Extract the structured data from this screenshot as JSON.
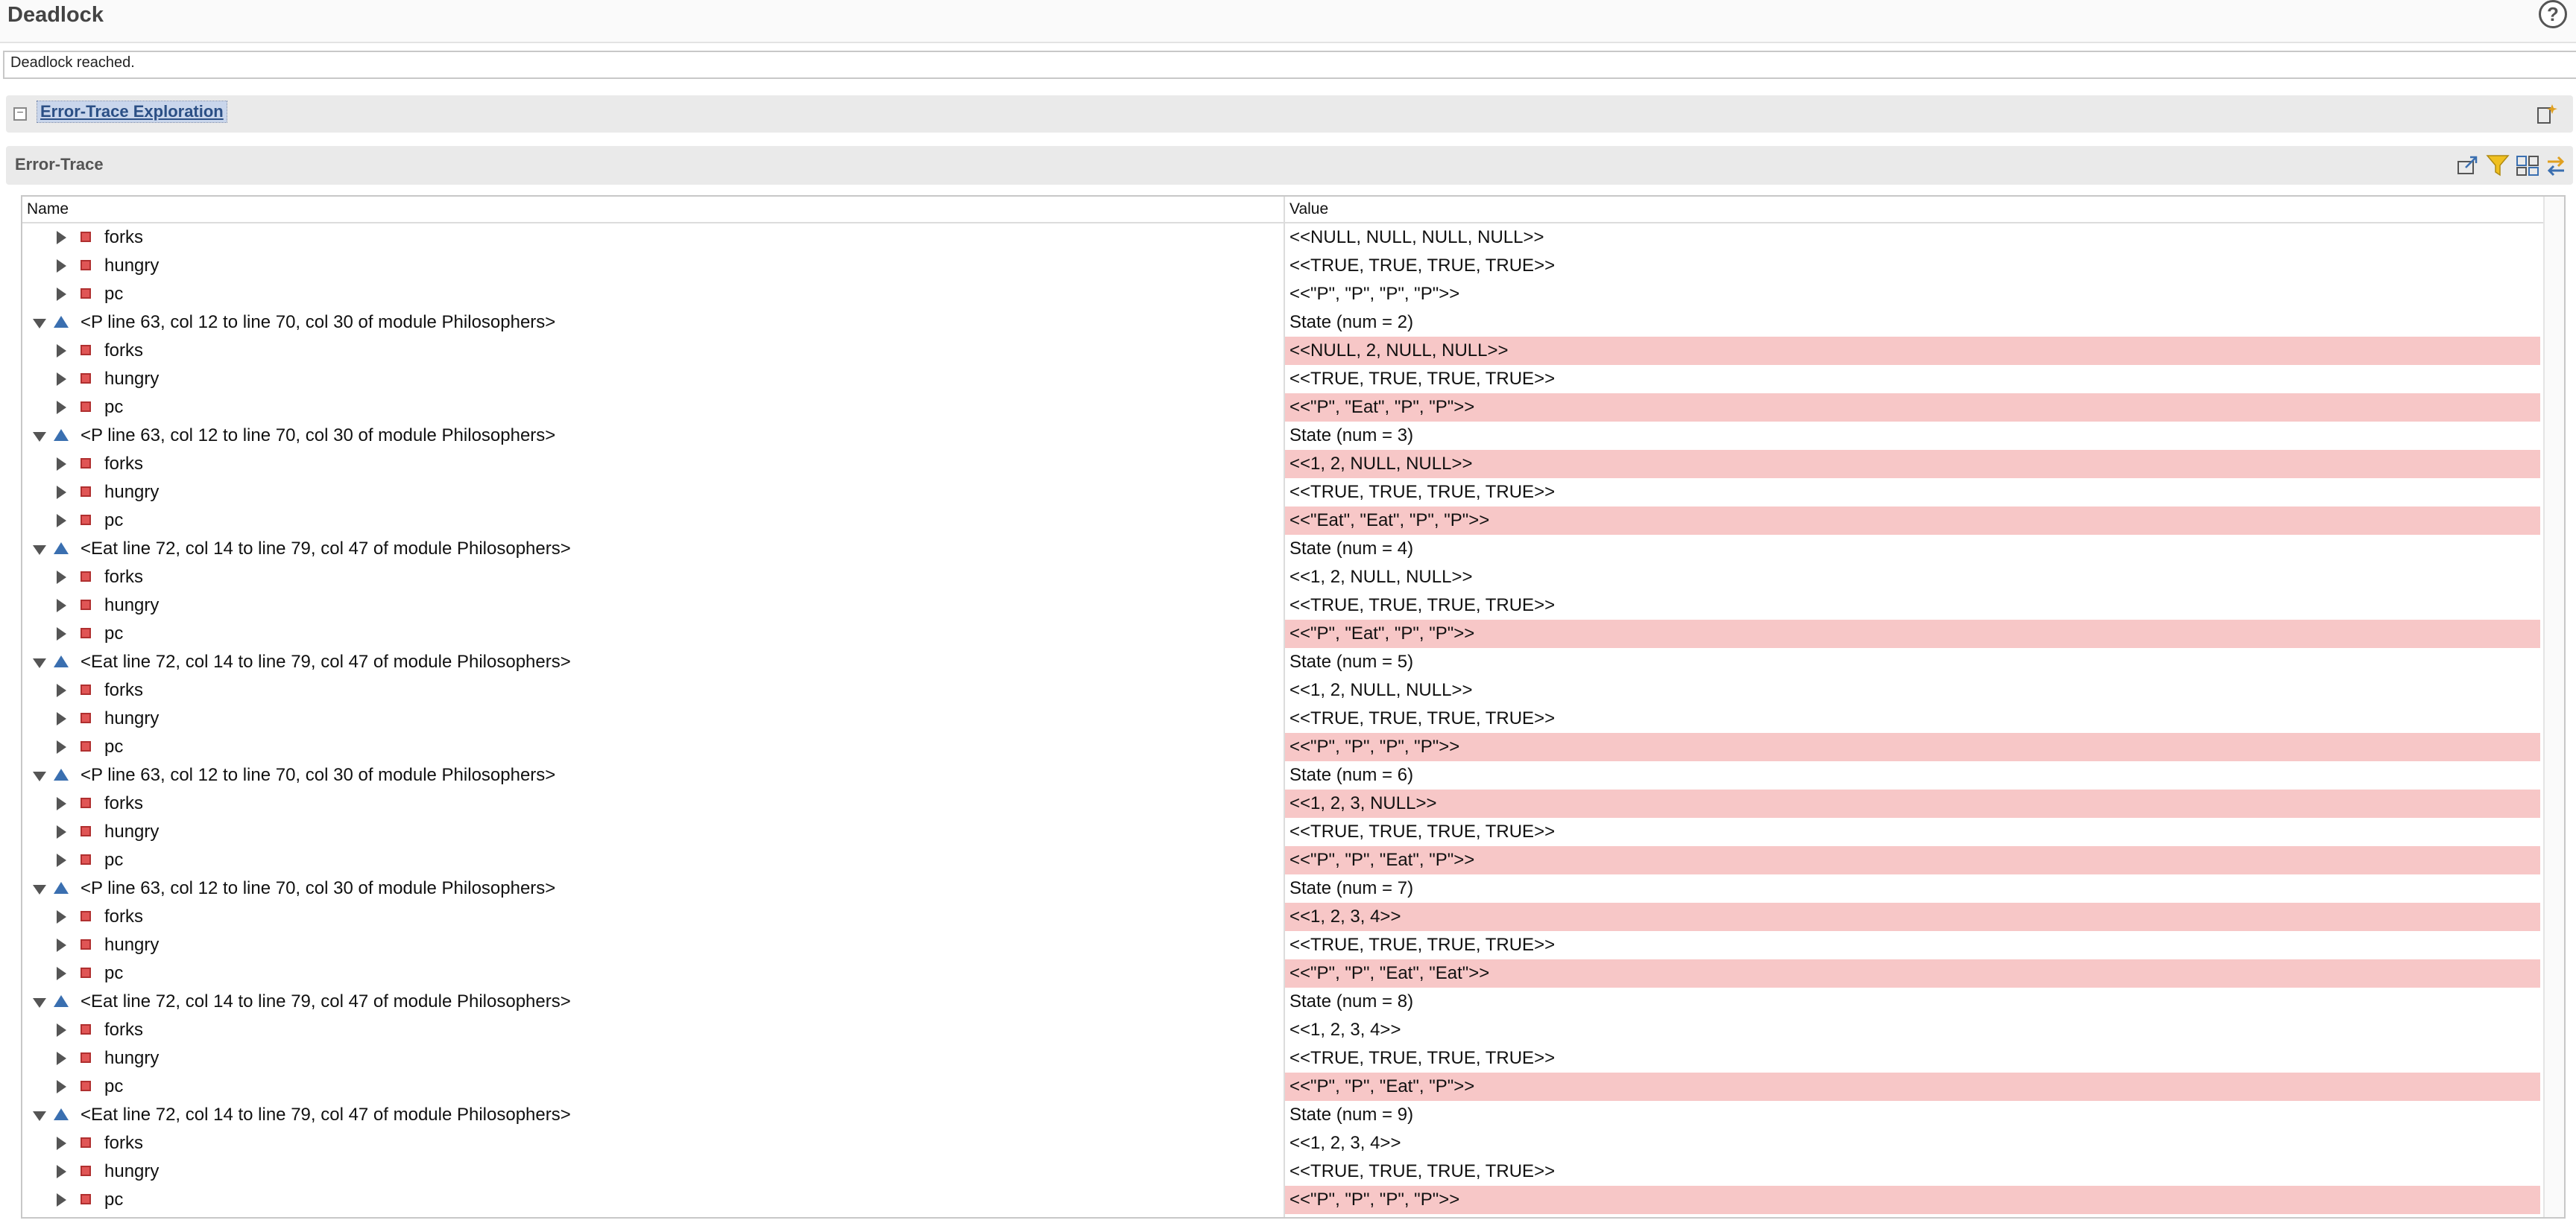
{
  "window": {
    "title": "Deadlock",
    "help_glyph": "?"
  },
  "status": {
    "message": "Deadlock reached."
  },
  "exploration": {
    "title": "Error-Trace Exploration"
  },
  "trace": {
    "title": "Error-Trace",
    "columns": {
      "name": "Name",
      "value": "Value"
    },
    "rows": [
      {
        "kind": "var",
        "name": "forks",
        "value": "<<NULL, NULL, NULL, NULL>>",
        "changed": false
      },
      {
        "kind": "var",
        "name": "hungry",
        "value": "<<TRUE, TRUE, TRUE, TRUE>>",
        "changed": false
      },
      {
        "kind": "var",
        "name": "pc",
        "value": "<<\"P\", \"P\", \"P\", \"P\">>",
        "changed": false
      },
      {
        "kind": "state",
        "name": "<P line 63, col 12 to line 70, col 30 of module Philosophers>",
        "value": "State (num = 2)",
        "changed": false
      },
      {
        "kind": "var",
        "name": "forks",
        "value": "<<NULL, 2, NULL, NULL>>",
        "changed": true
      },
      {
        "kind": "var",
        "name": "hungry",
        "value": "<<TRUE, TRUE, TRUE, TRUE>>",
        "changed": false
      },
      {
        "kind": "var",
        "name": "pc",
        "value": "<<\"P\", \"Eat\", \"P\", \"P\">>",
        "changed": true
      },
      {
        "kind": "state",
        "name": "<P line 63, col 12 to line 70, col 30 of module Philosophers>",
        "value": "State (num = 3)",
        "changed": false
      },
      {
        "kind": "var",
        "name": "forks",
        "value": "<<1, 2, NULL, NULL>>",
        "changed": true
      },
      {
        "kind": "var",
        "name": "hungry",
        "value": "<<TRUE, TRUE, TRUE, TRUE>>",
        "changed": false
      },
      {
        "kind": "var",
        "name": "pc",
        "value": "<<\"Eat\", \"Eat\", \"P\", \"P\">>",
        "changed": true
      },
      {
        "kind": "state",
        "name": "<Eat line 72, col 14 to line 79, col 47 of module Philosophers>",
        "value": "State (num = 4)",
        "changed": false
      },
      {
        "kind": "var",
        "name": "forks",
        "value": "<<1, 2, NULL, NULL>>",
        "changed": false
      },
      {
        "kind": "var",
        "name": "hungry",
        "value": "<<TRUE, TRUE, TRUE, TRUE>>",
        "changed": false
      },
      {
        "kind": "var",
        "name": "pc",
        "value": "<<\"P\", \"Eat\", \"P\", \"P\">>",
        "changed": true
      },
      {
        "kind": "state",
        "name": "<Eat line 72, col 14 to line 79, col 47 of module Philosophers>",
        "value": "State (num = 5)",
        "changed": false
      },
      {
        "kind": "var",
        "name": "forks",
        "value": "<<1, 2, NULL, NULL>>",
        "changed": false
      },
      {
        "kind": "var",
        "name": "hungry",
        "value": "<<TRUE, TRUE, TRUE, TRUE>>",
        "changed": false
      },
      {
        "kind": "var",
        "name": "pc",
        "value": "<<\"P\", \"P\", \"P\", \"P\">>",
        "changed": true
      },
      {
        "kind": "state",
        "name": "<P line 63, col 12 to line 70, col 30 of module Philosophers>",
        "value": "State (num = 6)",
        "changed": false
      },
      {
        "kind": "var",
        "name": "forks",
        "value": "<<1, 2, 3, NULL>>",
        "changed": true
      },
      {
        "kind": "var",
        "name": "hungry",
        "value": "<<TRUE, TRUE, TRUE, TRUE>>",
        "changed": false
      },
      {
        "kind": "var",
        "name": "pc",
        "value": "<<\"P\", \"P\", \"Eat\", \"P\">>",
        "changed": true
      },
      {
        "kind": "state",
        "name": "<P line 63, col 12 to line 70, col 30 of module Philosophers>",
        "value": "State (num = 7)",
        "changed": false
      },
      {
        "kind": "var",
        "name": "forks",
        "value": "<<1, 2, 3, 4>>",
        "changed": true
      },
      {
        "kind": "var",
        "name": "hungry",
        "value": "<<TRUE, TRUE, TRUE, TRUE>>",
        "changed": false
      },
      {
        "kind": "var",
        "name": "pc",
        "value": "<<\"P\", \"P\", \"Eat\", \"Eat\">>",
        "changed": true
      },
      {
        "kind": "state",
        "name": "<Eat line 72, col 14 to line 79, col 47 of module Philosophers>",
        "value": "State (num = 8)",
        "changed": false
      },
      {
        "kind": "var",
        "name": "forks",
        "value": "<<1, 2, 3, 4>>",
        "changed": false
      },
      {
        "kind": "var",
        "name": "hungry",
        "value": "<<TRUE, TRUE, TRUE, TRUE>>",
        "changed": false
      },
      {
        "kind": "var",
        "name": "pc",
        "value": "<<\"P\", \"P\", \"Eat\", \"P\">>",
        "changed": true
      },
      {
        "kind": "state",
        "name": "<Eat line 72, col 14 to line 79, col 47 of module Philosophers>",
        "value": "State (num = 9)",
        "changed": false
      },
      {
        "kind": "var",
        "name": "forks",
        "value": "<<1, 2, 3, 4>>",
        "changed": false
      },
      {
        "kind": "var",
        "name": "hungry",
        "value": "<<TRUE, TRUE, TRUE, TRUE>>",
        "changed": false
      },
      {
        "kind": "var",
        "name": "pc",
        "value": "<<\"P\", \"P\", \"P\", \"P\">>",
        "changed": true
      }
    ]
  },
  "colors": {
    "changed_highlight": "#f7c7c7",
    "section_title": "#2b4f85",
    "state_icon": "#3a6fb0",
    "var_icon": "#e05555"
  },
  "icons": [
    "help-icon",
    "collapse-icon",
    "section-settings-icon",
    "export-icon",
    "filter-icon",
    "expand-all-icon",
    "swap-icon",
    "expand-arrow-icon",
    "collapse-arrow-icon",
    "state-triangle-icon",
    "variable-square-icon"
  ]
}
